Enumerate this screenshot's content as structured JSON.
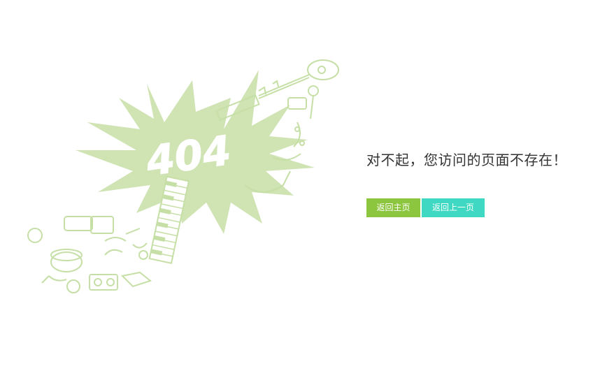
{
  "illustration": {
    "error_code": "404",
    "colors": {
      "burst": "#cfe3b3",
      "text_outline": "#ffffff",
      "line_art": "#c6dfa6"
    }
  },
  "error": {
    "message": "对不起，您访问的页面不存在！"
  },
  "actions": {
    "home_label": "返回主页",
    "back_label": "返回上一页"
  },
  "colors": {
    "home_button": "#8cc63f",
    "back_button": "#3fd9c3",
    "message_text": "#333333"
  }
}
